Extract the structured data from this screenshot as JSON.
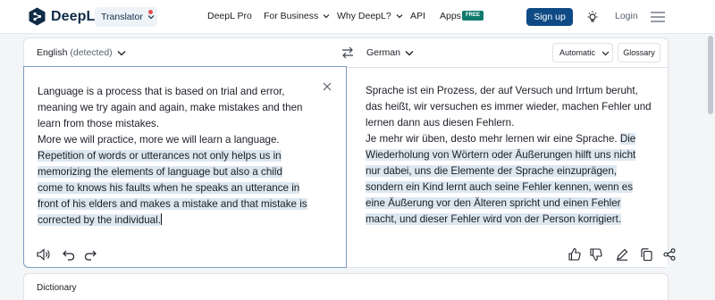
{
  "header": {
    "brand": "DeepL",
    "product_pill": "Translator",
    "nav": [
      {
        "label": "DeepL Pro"
      },
      {
        "label": "For Business"
      },
      {
        "label": "Why DeepL?"
      },
      {
        "label": "API"
      },
      {
        "label": "Apps"
      }
    ],
    "free_badge": "FREE",
    "signup_label": "Sign up",
    "login_label": "Login",
    "icons": [
      "deepl-logo-icon",
      "bulb-icon",
      "hamburger-menu-icon"
    ]
  },
  "translator": {
    "source_language": "English",
    "source_detected": "(detected)",
    "target_language": "German",
    "formality_label": "Automatic",
    "glossary_label": "Glossary",
    "source_lines": [
      "Language is a process that is based on trial and error,",
      "meaning we try again and again, make mistakes and then",
      "learn from those mistakes.",
      "More we will practice, more we will learn a language.",
      "Repetition of words or utterances not only helps us in",
      "memorizing the elements of language but also a child",
      "come to knows his faults when he speaks an utterance in",
      "front of his elders and makes a mistake and that mistake is",
      "corrected by the individual."
    ],
    "target_lines": [
      "Sprache ist ein Prozess, der auf Versuch und Irrtum beruht,",
      "das heißt, wir versuchen es immer wieder, machen Fehler und",
      "lernen dann aus diesen Fehlern.",
      "Je mehr wir üben, desto mehr lernen wir eine Sprache.",
      "Die",
      "Wiederholung von Wörtern oder Äußerungen hilft uns nicht",
      "nur dabei, uns die Elemente der Sprache einzuprägen,",
      "sondern ein Kind lernt auch seine Fehler kennen, wenn es",
      "eine Äußerung vor den Älteren spricht und einen Fehler",
      "macht, und dieser Fehler wird von der Person korrigiert."
    ],
    "highlight_color": "#dde7f0"
  },
  "dictionary": {
    "title": "Dictionary"
  },
  "colors": {
    "brand_navy": "#0f2b46",
    "signup_blue": "#0f4a85",
    "free_green": "#0f7b6c",
    "notification_red": "#e64c4c"
  }
}
